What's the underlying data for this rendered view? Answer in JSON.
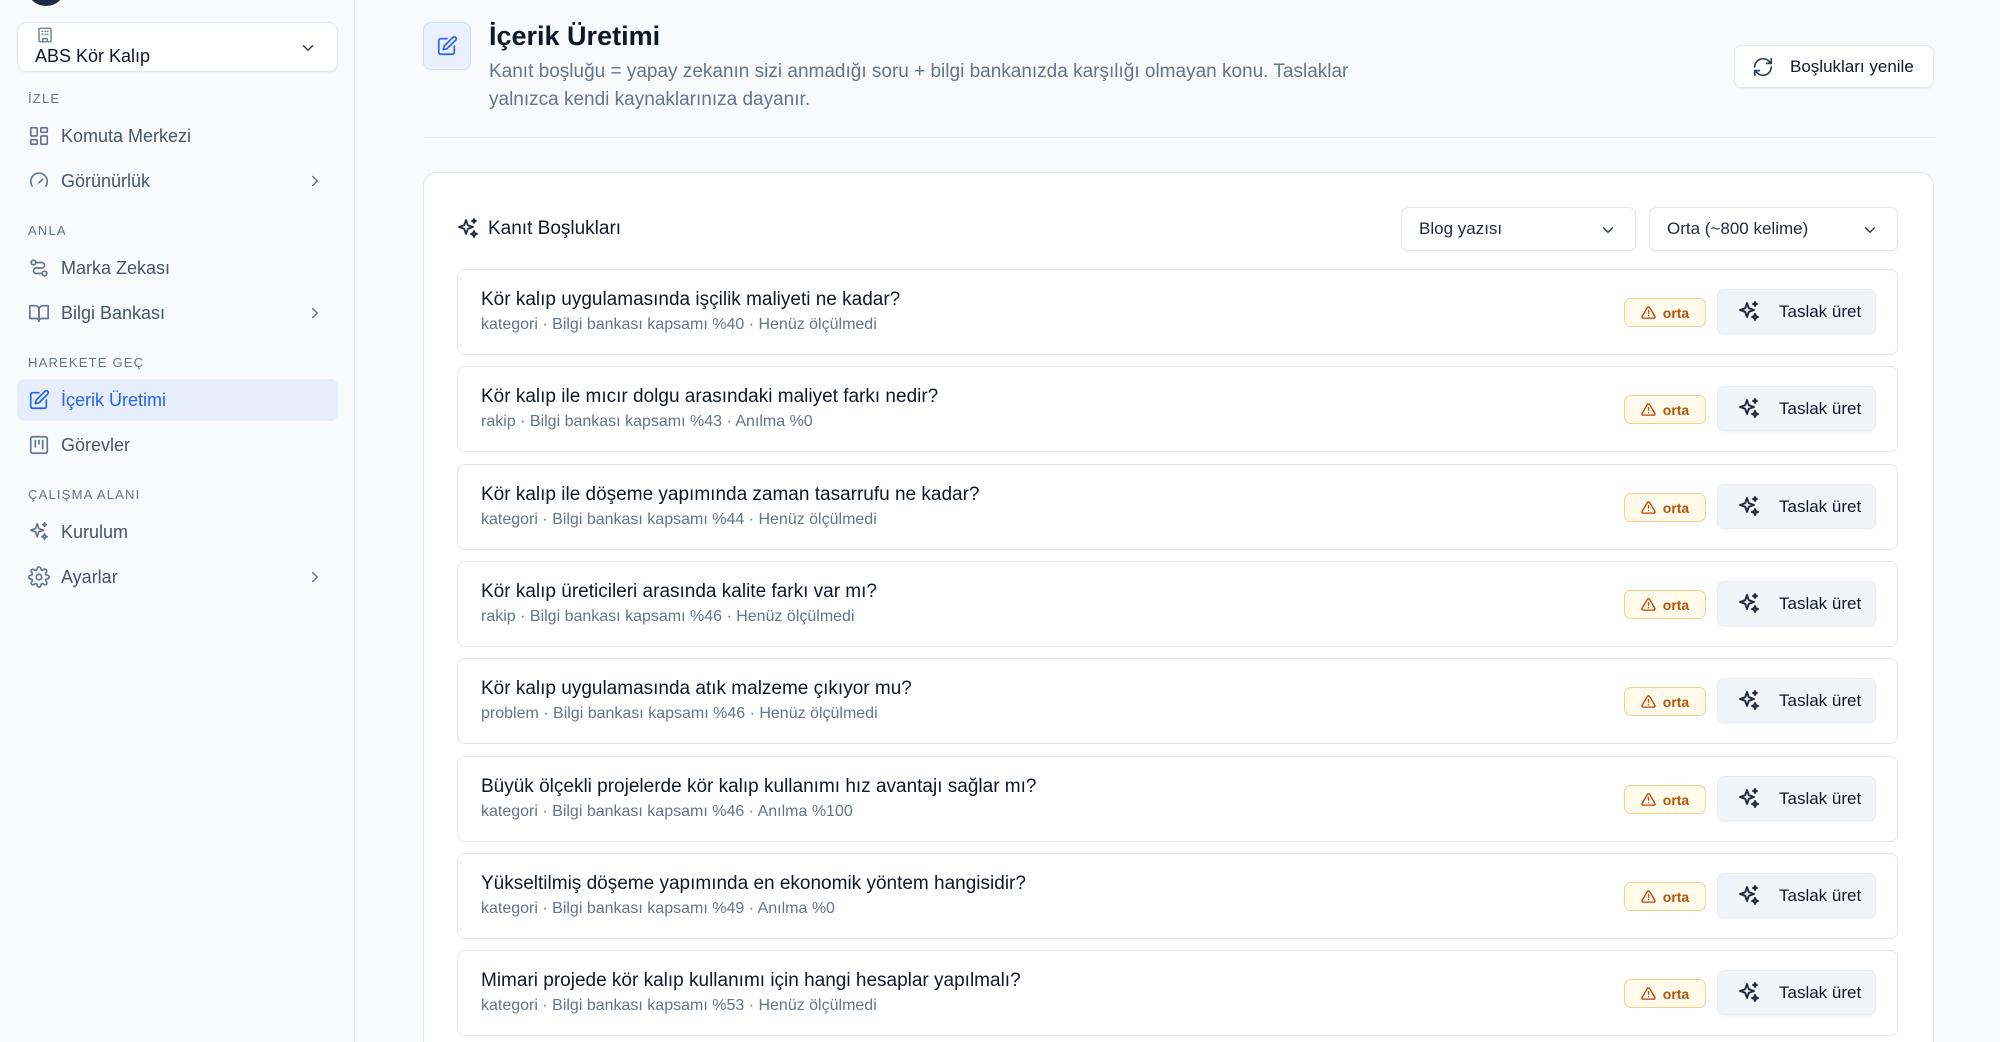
{
  "sidebar": {
    "workspace": {
      "name": "ABS Kör Kalıp"
    },
    "sections": [
      {
        "label": "İZLE"
      },
      {
        "label": "ANLA"
      },
      {
        "label": "HAREKETE GEÇ"
      },
      {
        "label": "ÇALIŞMA ALANI"
      }
    ],
    "items": [
      {
        "label": "Komuta Merkezi"
      },
      {
        "label": "Görünürlük"
      },
      {
        "label": "Marka Zekası"
      },
      {
        "label": "Bilgi Bankası"
      },
      {
        "label": "İçerik Üretimi"
      },
      {
        "label": "Görevler"
      },
      {
        "label": "Kurulum"
      },
      {
        "label": "Ayarlar"
      }
    ]
  },
  "header": {
    "title": "İçerik Üretimi",
    "description": "Kanıt boşluğu = yapay zekanın sizi anmadığı soru + bilgi bankanızda karşılığı olmayan konu. Taslaklar yalnızca kendi kaynaklarınıza dayanır.",
    "refresh_label": "Boşlukları yenile"
  },
  "card": {
    "title": "Kanıt Boşlukları",
    "format_select": "Blog yazısı",
    "length_select": "Orta (~800 kelime)",
    "draft_label": "Taslak üret",
    "rows": [
      {
        "question": "Kör kalıp uygulamasında işçilik maliyeti ne kadar?",
        "meta": "kategori · Bilgi bankası kapsamı %40 · Henüz ölçülmedi",
        "severity": "orta"
      },
      {
        "question": "Kör kalıp ile mıcır dolgu arasındaki maliyet farkı nedir?",
        "meta": "rakip · Bilgi bankası kapsamı %43 · Anılma %0",
        "severity": "orta"
      },
      {
        "question": "Kör kalıp ile döşeme yapımında zaman tasarrufu ne kadar?",
        "meta": "kategori · Bilgi bankası kapsamı %44 · Henüz ölçülmedi",
        "severity": "orta"
      },
      {
        "question": "Kör kalıp üreticileri arasında kalite farkı var mı?",
        "meta": "rakip · Bilgi bankası kapsamı %46 · Henüz ölçülmedi",
        "severity": "orta"
      },
      {
        "question": "Kör kalıp uygulamasında atık malzeme çıkıyor mu?",
        "meta": "problem · Bilgi bankası kapsamı %46 · Henüz ölçülmedi",
        "severity": "orta"
      },
      {
        "question": "Büyük ölçekli projelerde kör kalıp kullanımı hız avantajı sağlar mı?",
        "meta": "kategori · Bilgi bankası kapsamı %46 · Anılma %100",
        "severity": "orta"
      },
      {
        "question": "Yükseltilmiş döşeme yapımında en ekonomik yöntem hangisidir?",
        "meta": "kategori · Bilgi bankası kapsamı %49 · Anılma %0",
        "severity": "orta"
      },
      {
        "question": "Mimari projede kör kalıp kullanımı için hangi hesaplar yapılmalı?",
        "meta": "kategori · Bilgi bankası kapsamı %53 · Henüz ölçülmedi",
        "severity": "orta"
      }
    ]
  },
  "colors": {
    "accent": "#2563eb",
    "warning": "#b45309",
    "warning_border": "#f6cf8b"
  }
}
